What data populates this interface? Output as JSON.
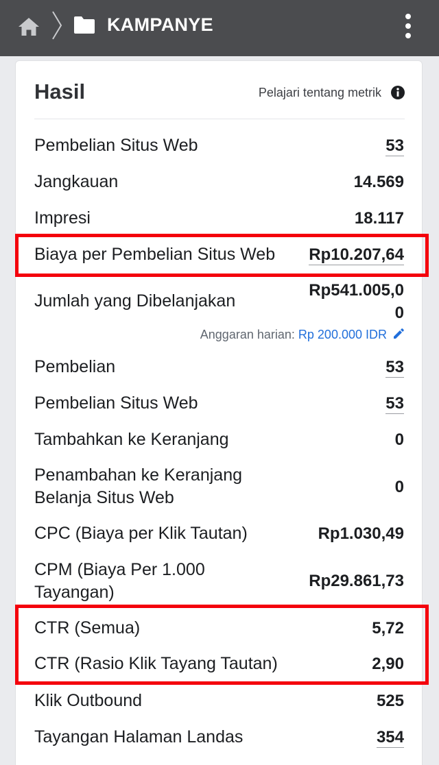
{
  "topbar": {
    "title": "KAMPANYE",
    "icons": [
      "home-icon",
      "chevron-right-icon",
      "folder-icon",
      "more-vertical-icon"
    ]
  },
  "results": {
    "title": "Hasil",
    "learn_link": "Pelajari tentang metrik",
    "info_icon": "info-icon",
    "budget": {
      "label": "Anggaran harian:",
      "value": "Rp 200.000 IDR",
      "edit_icon": "pencil-icon"
    },
    "metrics": [
      {
        "label": "Pembelian Situs Web",
        "value": "53"
      },
      {
        "label": "Jangkauan",
        "value": "14.569"
      },
      {
        "label": "Impresi",
        "value": "18.117"
      },
      {
        "label": "Biaya per Pembelian Situs Web",
        "value": "Rp10.207,64"
      },
      {
        "label": "Jumlah yang Dibelanjakan",
        "value": "Rp541.005,00"
      },
      {
        "label": "Pembelian",
        "value": "53"
      },
      {
        "label": "Pembelian Situs Web",
        "value": "53"
      },
      {
        "label": "Tambahkan ke Keranjang",
        "value": "0"
      },
      {
        "label": "Penambahan ke Keranjang Belanja Situs Web",
        "value": "0"
      },
      {
        "label": "CPC (Biaya per Klik Tautan)",
        "value": "Rp1.030,49"
      },
      {
        "label": "CPM (Biaya Per 1.000 Tayangan)",
        "value": "Rp29.861,73"
      },
      {
        "label": "CTR (Semua)",
        "value": "5,72"
      },
      {
        "label": "CTR (Rasio Klik Tayang Tautan)",
        "value": "2,90"
      },
      {
        "label": "Klik Outbound",
        "value": "525"
      },
      {
        "label": "Tayangan Halaman Landas",
        "value": "354"
      }
    ]
  },
  "colors": {
    "topbar": "#4b4c4f",
    "highlight_border": "#f4000c",
    "link": "#216fdb",
    "background": "#eaebee"
  }
}
